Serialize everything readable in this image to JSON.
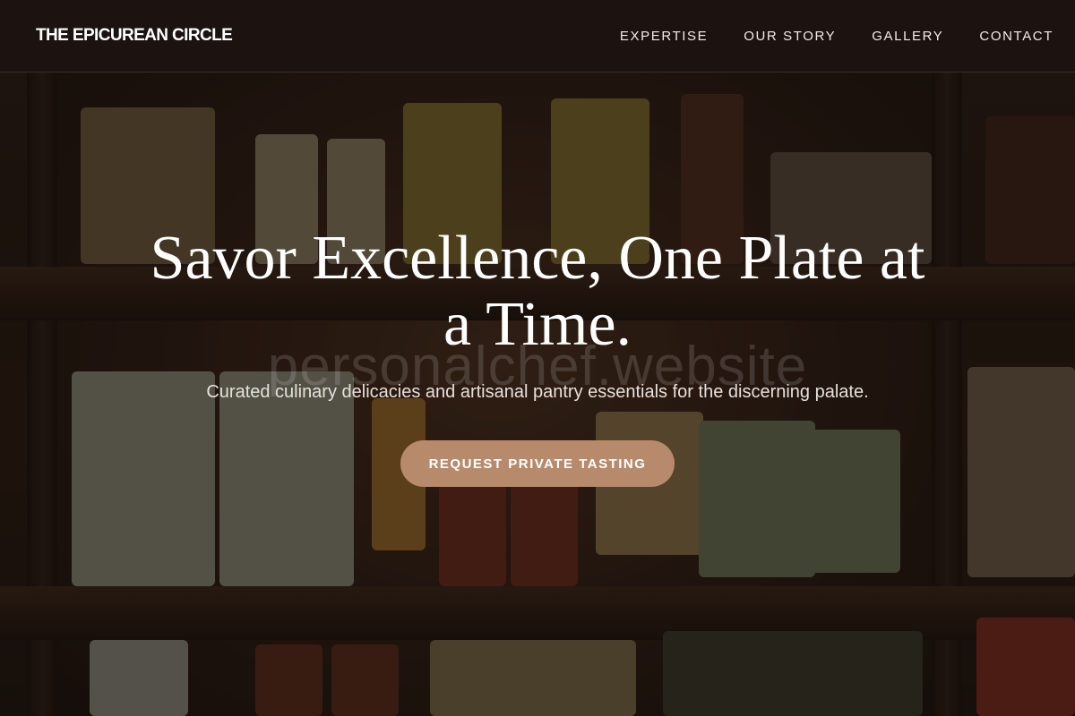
{
  "header": {
    "brand": "THE EPICUREAN CIRCLE",
    "nav": [
      {
        "label": "EXPERTISE"
      },
      {
        "label": "OUR STORY"
      },
      {
        "label": "GALLERY"
      },
      {
        "label": "CONTACT"
      }
    ]
  },
  "hero": {
    "headline": "Savor Excellence, One Plate at a Time.",
    "subtitle": "Curated culinary delicacies and artisanal pantry essentials for the discerning palate.",
    "cta_label": "REQUEST PRIVATE TASTING",
    "watermark": "personalchef.website"
  },
  "colors": {
    "header_bg": "#1c1310",
    "accent": "#b88a6c",
    "text": "#ffffff"
  }
}
